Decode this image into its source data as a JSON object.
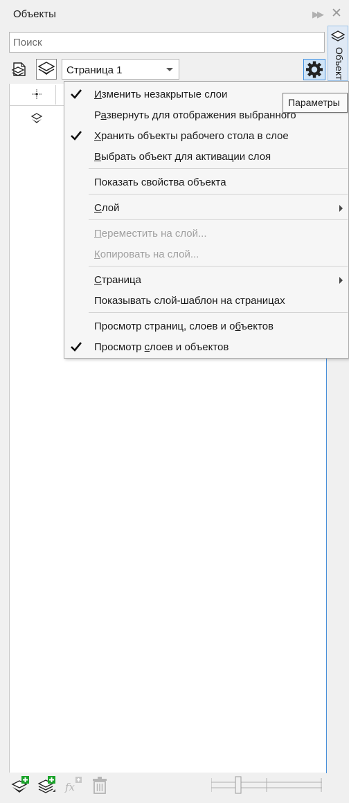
{
  "panel": {
    "title": "Объекты",
    "side_tab_label": "Объекты"
  },
  "search": {
    "placeholder": "Поиск",
    "value": ""
  },
  "toolbar": {
    "page_selected": "Страница 1"
  },
  "tooltip": {
    "text": "Параметры"
  },
  "menu": {
    "items": [
      {
        "label_pre": "",
        "accel": "И",
        "label_post": "зменить незакрытые слои",
        "checked": true,
        "enabled": true,
        "submenu": false
      },
      {
        "label_pre": "Р",
        "accel": "а",
        "label_post": "звернуть для отображения выбранного",
        "checked": false,
        "enabled": true,
        "submenu": false
      },
      {
        "label_pre": "",
        "accel": "Х",
        "label_post": "ранить объекты рабочего стола в слое",
        "checked": true,
        "enabled": true,
        "submenu": false
      },
      {
        "label_pre": "",
        "accel": "В",
        "label_post": "ыбрать объект для активации слоя",
        "checked": false,
        "enabled": true,
        "submenu": false
      },
      {
        "label_pre": "Показать свойства объекта",
        "accel": "",
        "label_post": "",
        "checked": false,
        "enabled": true,
        "submenu": false
      },
      {
        "label_pre": "",
        "accel": "С",
        "label_post": "лой",
        "checked": false,
        "enabled": true,
        "submenu": true
      },
      {
        "label_pre": "",
        "accel": "П",
        "label_post": "ереместить на слой...",
        "checked": false,
        "enabled": false,
        "submenu": false
      },
      {
        "label_pre": "",
        "accel": "К",
        "label_post": "опировать на слой...",
        "checked": false,
        "enabled": false,
        "submenu": false
      },
      {
        "label_pre": "",
        "accel": "С",
        "label_post": "траница",
        "checked": false,
        "enabled": true,
        "submenu": true
      },
      {
        "label_pre": "Показывать слой-шаблон на страницах",
        "accel": "",
        "label_post": "",
        "checked": false,
        "enabled": true,
        "submenu": false
      },
      {
        "label_pre": "Просмотр страниц, слоев и о",
        "accel": "б",
        "label_post": "ъектов",
        "checked": false,
        "enabled": true,
        "submenu": false
      },
      {
        "label_pre": "Просмотр ",
        "accel": "с",
        "label_post": "лоев и объектов",
        "checked": true,
        "enabled": true,
        "submenu": false
      }
    ]
  },
  "icons": {
    "expand": "double-chevron-right-icon",
    "close": "close-icon",
    "page": "page-layers-icon",
    "layer": "layers-icon",
    "options": "gear-icon",
    "new_layer": "new-layer-icon",
    "new_master_layer": "new-master-layer-icon",
    "effects": "fx-icon",
    "delete": "trash-icon"
  },
  "colors": {
    "accent": "#3d8ee0",
    "new_icon_green": "#1aa32a"
  }
}
